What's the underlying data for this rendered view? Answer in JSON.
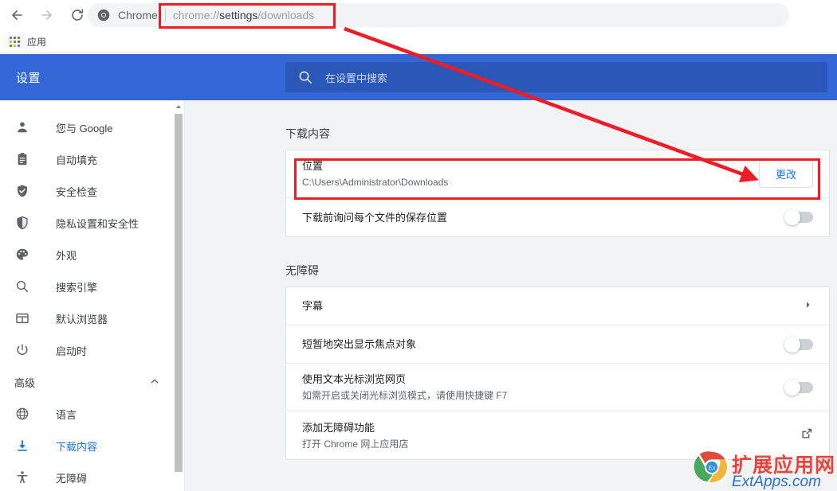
{
  "browser": {
    "back_icon": "back-arrow-icon",
    "forward_icon": "forward-arrow-icon",
    "reload_icon": "reload-icon",
    "omnibox": {
      "site_label": "Chrome",
      "url_prefix": "chrome://",
      "url_bold": "settings",
      "url_suffix": "/downloads",
      "full_url": "chrome://settings/downloads"
    },
    "bookmarks": {
      "apps_label": "应用"
    }
  },
  "settings": {
    "title": "设置",
    "search_placeholder": "在设置中搜索",
    "header_color": "#3367d6",
    "search_box_color": "#2b58b8"
  },
  "sidebar": {
    "items": [
      {
        "label": "您与 Google",
        "icon": "person-icon",
        "active": false
      },
      {
        "label": "自动填充",
        "icon": "clipboard-icon",
        "active": false
      },
      {
        "label": "安全检查",
        "icon": "shield-check-icon",
        "active": false
      },
      {
        "label": "隐私设置和安全性",
        "icon": "shield-half-icon",
        "active": false
      },
      {
        "label": "外观",
        "icon": "palette-icon",
        "active": false
      },
      {
        "label": "搜索引擎",
        "icon": "search-icon",
        "active": false
      },
      {
        "label": "默认浏览器",
        "icon": "browser-window-icon",
        "active": false
      },
      {
        "label": "启动时",
        "icon": "power-icon",
        "active": false
      }
    ],
    "advanced_label": "高级",
    "advanced_expanded_icon": "chevron-up-icon",
    "advanced_items": [
      {
        "label": "语言",
        "icon": "globe-icon",
        "active": false
      },
      {
        "label": "下载内容",
        "icon": "download-icon",
        "active": true
      },
      {
        "label": "无障碍",
        "icon": "accessibility-icon",
        "active": false
      }
    ]
  },
  "main": {
    "downloads": {
      "section_title": "下载内容",
      "location_title": "位置",
      "location_path": "C:\\Users\\Administrator\\Downloads",
      "change_button": "更改",
      "ask_title": "下载前询问每个文件的保存位置",
      "ask_toggle_state": "off"
    },
    "accessibility": {
      "section_title": "无障碍",
      "captions_title": "字幕",
      "captions_chevron": "chevron-right-icon",
      "highlight_title": "短暂地突出显示焦点对象",
      "highlight_toggle_state": "off",
      "caret_title": "使用文本光标浏览网页",
      "caret_sub": "如需开启或关闭光标浏览模式，请使用快捷键 F7",
      "caret_toggle_state": "off",
      "addfeature_title": "添加无障碍功能",
      "addfeature_sub": "打开 Chrome 网上应用店",
      "addfeature_icon": "external-link-icon"
    }
  },
  "watermark": {
    "chinese": "扩展应用网",
    "english": "ExtApps.com",
    "badge": "Ex"
  },
  "annotations": {
    "highlight_color": "#ee1c25",
    "url_box": "chrome://settings/downloads",
    "location_box": "位置",
    "arrow": "red-arrow-pointer"
  }
}
